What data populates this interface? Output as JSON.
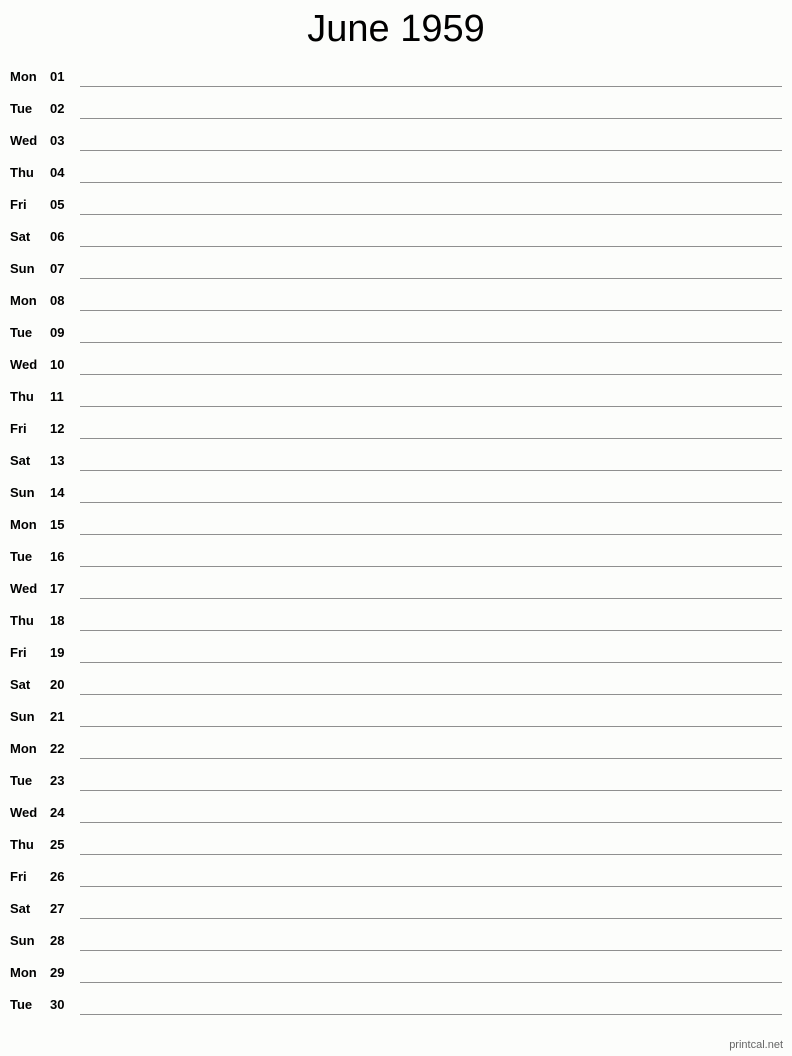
{
  "title": "June 1959",
  "days": [
    {
      "weekday": "Mon",
      "date": "01"
    },
    {
      "weekday": "Tue",
      "date": "02"
    },
    {
      "weekday": "Wed",
      "date": "03"
    },
    {
      "weekday": "Thu",
      "date": "04"
    },
    {
      "weekday": "Fri",
      "date": "05"
    },
    {
      "weekday": "Sat",
      "date": "06"
    },
    {
      "weekday": "Sun",
      "date": "07"
    },
    {
      "weekday": "Mon",
      "date": "08"
    },
    {
      "weekday": "Tue",
      "date": "09"
    },
    {
      "weekday": "Wed",
      "date": "10"
    },
    {
      "weekday": "Thu",
      "date": "11"
    },
    {
      "weekday": "Fri",
      "date": "12"
    },
    {
      "weekday": "Sat",
      "date": "13"
    },
    {
      "weekday": "Sun",
      "date": "14"
    },
    {
      "weekday": "Mon",
      "date": "15"
    },
    {
      "weekday": "Tue",
      "date": "16"
    },
    {
      "weekday": "Wed",
      "date": "17"
    },
    {
      "weekday": "Thu",
      "date": "18"
    },
    {
      "weekday": "Fri",
      "date": "19"
    },
    {
      "weekday": "Sat",
      "date": "20"
    },
    {
      "weekday": "Sun",
      "date": "21"
    },
    {
      "weekday": "Mon",
      "date": "22"
    },
    {
      "weekday": "Tue",
      "date": "23"
    },
    {
      "weekday": "Wed",
      "date": "24"
    },
    {
      "weekday": "Thu",
      "date": "25"
    },
    {
      "weekday": "Fri",
      "date": "26"
    },
    {
      "weekday": "Sat",
      "date": "27"
    },
    {
      "weekday": "Sun",
      "date": "28"
    },
    {
      "weekday": "Mon",
      "date": "29"
    },
    {
      "weekday": "Tue",
      "date": "30"
    }
  ],
  "footer": "printcal.net"
}
